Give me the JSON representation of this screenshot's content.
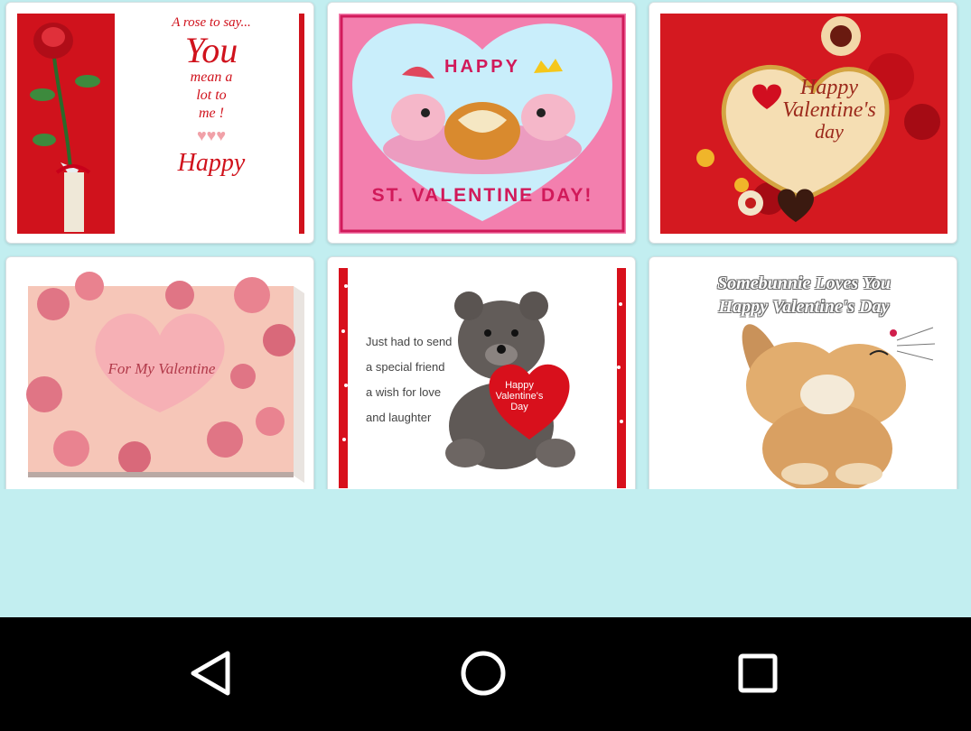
{
  "cards": [
    {
      "name": "rose-card",
      "lines": [
        "A rose to say...",
        "You",
        "mean a",
        "lot to",
        "me !",
        "Happy"
      ]
    },
    {
      "name": "happy-st-valentine-card",
      "top_text": "HAPPY",
      "bottom_text": "ST. VALENTINE DAY!"
    },
    {
      "name": "golden-heart-card",
      "lines": [
        "Happy",
        "Valentine's",
        "day"
      ]
    },
    {
      "name": "roses-valentine-card",
      "text": "For My Valentine"
    },
    {
      "name": "teddy-bear-card",
      "lines": [
        "Just had to send",
        "a special friend",
        "a wish for love",
        "and laughter"
      ],
      "heart_lines": [
        "Happy",
        "Valentine's",
        "Day"
      ]
    },
    {
      "name": "bunny-card",
      "lines": [
        "Somebunnie Loves You",
        "Happy Valentine's Day"
      ]
    }
  ],
  "colors": {
    "background": "#c2eef0",
    "navbar": "#000000",
    "nav_icon": "#ffffff",
    "valentine_red": "#d0121c"
  },
  "navbar": {
    "back_icon": "back-triangle",
    "home_icon": "home-circle",
    "recents_icon": "recents-square"
  }
}
